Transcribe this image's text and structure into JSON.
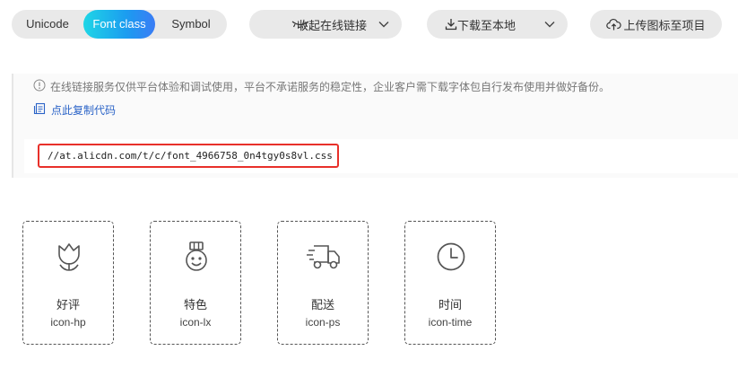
{
  "tabs": [
    {
      "id": "unicode",
      "label": "Unicode"
    },
    {
      "id": "fontclass",
      "label": "Font class",
      "active": true
    },
    {
      "id": "symbol",
      "label": "Symbol"
    }
  ],
  "actions": {
    "collapse_label": "收起在线链接",
    "download_label": "下载至本地",
    "upload_label": "上传图标至项目"
  },
  "panel": {
    "notice": "在线链接服务仅供平台体验和调试使用，平台不承诺服务的稳定性，企业客户需下载字体包自行发布使用并做好备份。",
    "copy_label": "点此复制代码",
    "css_url": "//at.alicdn.com/t/c/font_4966758_0n4tgy0s8vl.css"
  },
  "icons": [
    {
      "name": "好评",
      "class": "icon-hp",
      "glyph": "tulip-icon"
    },
    {
      "name": "特色",
      "class": "icon-lx",
      "glyph": "medal-icon"
    },
    {
      "name": "配送",
      "class": "icon-ps",
      "glyph": "delivery-truck-icon"
    },
    {
      "name": "时间",
      "class": "icon-time",
      "glyph": "clock-icon"
    }
  ],
  "colors": {
    "accent_start": "#1fd6e6",
    "accent_end": "#3a7cf5",
    "link": "#2a63c7",
    "highlight_border": "#e8302a"
  }
}
